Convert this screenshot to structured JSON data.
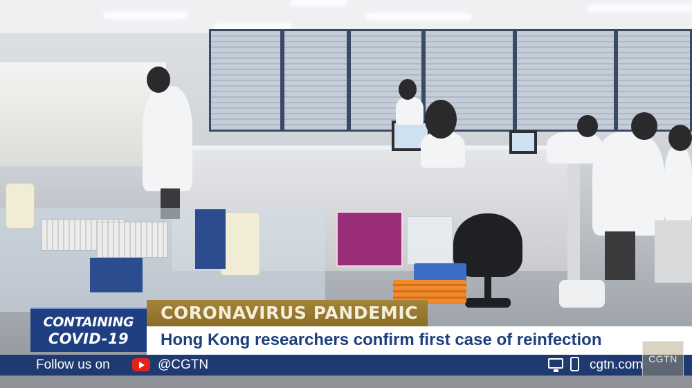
{
  "video": {
    "description_icons": [
      "youtube-icon",
      "monitor-icon",
      "phone-icon"
    ]
  },
  "lower_third": {
    "logo": {
      "line1": "CONTAINING",
      "line2": "COVID-19"
    },
    "category": "CORONAVIRUS PANDEMIC",
    "headline": "Hong Kong researchers confirm first case of reinfection"
  },
  "footer": {
    "follow_label": "Follow us on",
    "handle": "@CGTN",
    "website": "cgtn.com"
  },
  "watermark": {
    "text": "CGTN"
  },
  "colors": {
    "brand_blue": "#1f3f82",
    "category_gold": "#a3843a",
    "headline_text": "#1d3f7e",
    "youtube_red": "#e62117"
  }
}
